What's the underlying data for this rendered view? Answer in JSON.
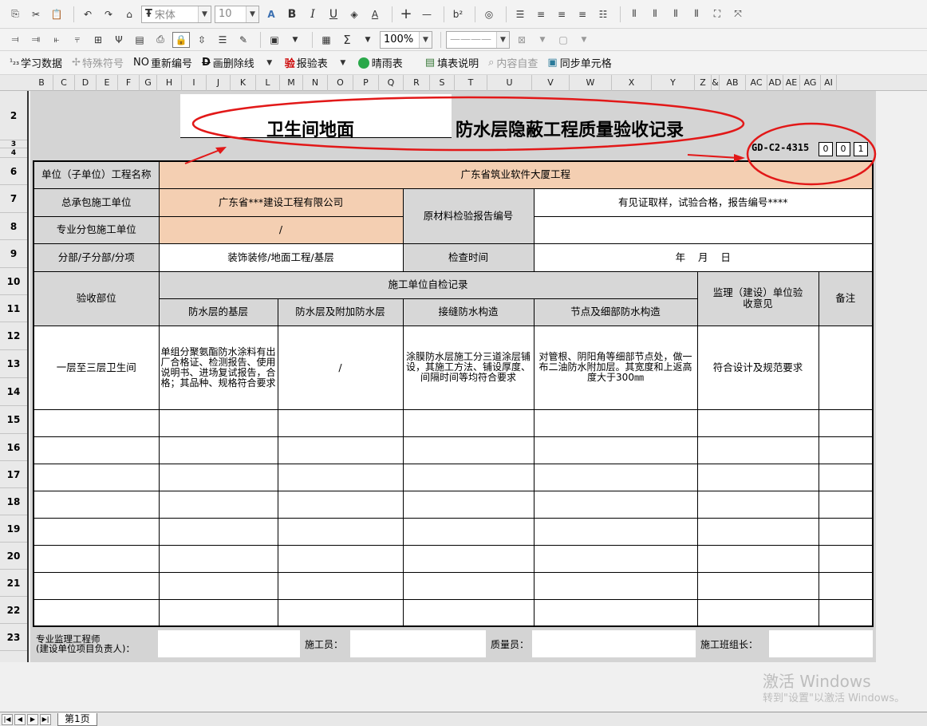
{
  "toolbar1": {
    "font_name": "宋体",
    "font_size": "10",
    "bold": "B",
    "italic": "I",
    "underline": "U",
    "plus": "+",
    "minus": "—",
    "superscript": "b²"
  },
  "toolbar2": {
    "sum": "Σ",
    "zoom": "100%",
    "line_style": "————"
  },
  "toolbar3": {
    "learn_data": "学习数据",
    "special_char": "特殊符号",
    "renumber": "重新编号",
    "strike": "画删除线",
    "report": "报验表",
    "clear_table": "晴雨表",
    "fill_desc": "填表说明",
    "content_check": "内容自查",
    "sync_cell": "同步单元格",
    "learn_prefix": "¹₂₃",
    "renumber_prefix": "NO",
    "strike_prefix": "D",
    "report_prefix": "验"
  },
  "columns": [
    "B",
    "C",
    "D",
    "E",
    "F",
    "G",
    "H",
    "I",
    "J",
    "K",
    "L",
    "M",
    "N",
    "O",
    "P",
    "Q",
    "R",
    "S",
    "T",
    "U",
    "V",
    "W",
    "X",
    "Y",
    "Z",
    "&",
    "AB",
    "AC",
    "AD",
    "AE",
    "AG",
    "AI"
  ],
  "rows": [
    "2",
    "3",
    "4",
    "6",
    "7",
    "8",
    "9",
    "10",
    "11",
    "12",
    "13",
    "14",
    "15",
    "16",
    "17",
    "18",
    "19",
    "20",
    "21",
    "22",
    "23"
  ],
  "doc": {
    "title_left": "卫生间地面",
    "title_right": "防水层隐蔽工程质量验收记录",
    "form_code": "GD-C2-4315",
    "code_digits": [
      "0",
      "0",
      "1"
    ],
    "project_name_label": "单位（子单位）工程名称",
    "project_name": "广东省筑业软件大厦工程",
    "general_contractor_label": "总承包施工单位",
    "general_contractor": "广东省***建设工程有限公司",
    "material_report_label": "原材料检验报告编号",
    "material_report": "有见证取样，试验合格，报告编号****",
    "subcontractor_label": "专业分包施工单位",
    "subcontractor": "/",
    "division_label": "分部/子分部/分项",
    "division": "装饰装修/地面工程/基层",
    "check_time_label": "检查时间",
    "check_time": "年    月    日",
    "acceptance_part_label": "验收部位",
    "self_check_label": "施工单位自检记录",
    "supervision_label": "监理（建设）单位验收意见",
    "remarks_label": "备注",
    "col_base": "防水层的基层",
    "col_layer": "防水层及附加防水层",
    "col_joint": "接缝防水构造",
    "col_node": "节点及细部防水构造",
    "row_part": "一层至三层卫生间",
    "row_base": "单组分聚氨酯防水涂料有出厂合格证、检测报告、使用说明书、进场复试报告，合格；其品种、规格符合要求",
    "row_layer": "/",
    "row_joint": "涂膜防水层施工分三道涂层铺设，其施工方法、铺设厚度、间隔时间等均符合要求",
    "row_node": "对管根、阴阳角等细部节点处，做一布二油防水附加层。其宽度和上返高度大于300㎜",
    "row_opinion": "符合设计及规范要求",
    "sign_supervisor": "专业监理工程师\n(建设单位项目负责人)：",
    "sign_worker": "施工员：",
    "sign_quality": "质量员：",
    "sign_team": "施工班组长："
  },
  "sheet_tab": "第1页",
  "watermark": {
    "line1": "激活 Windows",
    "line2": "转到\"设置\"以激活 Windows。"
  },
  "annotation_color": "#e21818"
}
